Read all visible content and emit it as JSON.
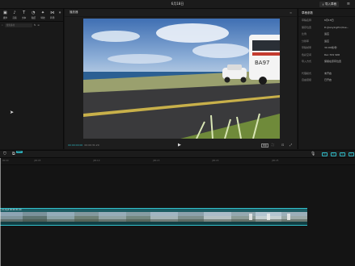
{
  "titlebar": {
    "project_date": "6月18日",
    "share_label": "导入草稿",
    "menu_glyph": "≡"
  },
  "toolbar": {
    "items": [
      {
        "icon": "media-icon",
        "glyph": "▣",
        "label": "媒体"
      },
      {
        "icon": "audio-icon",
        "glyph": "♪",
        "label": "音频"
      },
      {
        "icon": "text-icon",
        "glyph": "T",
        "label": "文本"
      },
      {
        "icon": "sticker-icon",
        "glyph": "◔",
        "label": "贴纸"
      },
      {
        "icon": "effects-icon",
        "glyph": "✦",
        "label": "特效"
      },
      {
        "icon": "transition-icon",
        "glyph": "⋈",
        "label": "转场"
      }
    ],
    "more_glyph": "»"
  },
  "media_search": {
    "placeholder": "搜索素材",
    "sort_glyph": "⇅",
    "filter_glyph": "≡"
  },
  "player": {
    "header": "播放器",
    "options_glyph": "≡",
    "current_time": "00:00:00:00",
    "total_time": "00:00:31:20",
    "play_glyph": "▶",
    "ratio_label": "原始",
    "bus_text": "BA97"
  },
  "details": {
    "header": "草稿参数",
    "rows": [
      {
        "key": "草稿名称",
        "value": "6月18日"
      },
      {
        "key": "保存位置",
        "value": "D:/JianyingPro/Use..."
      },
      {
        "key": "比例",
        "value": "适应"
      },
      {
        "key": "分辨率",
        "value": "适应"
      },
      {
        "key": "草稿帧率",
        "value": "30.00帧/秒"
      },
      {
        "key": "色彩空间",
        "value": "Rec.709 SDR"
      },
      {
        "key": "导入方式",
        "value": "保留在原有位置"
      },
      {
        "key": "代理模式",
        "value": "未开启"
      },
      {
        "key": "自由层级",
        "value": "已开启"
      }
    ]
  },
  "timeline": {
    "badge": "NEW",
    "ruler": [
      "00:00",
      "|00:05",
      "|00:10",
      "|00:15",
      "|00:20",
      "|00:25"
    ],
    "clip_label": "21.mp4  00:00:31:20"
  },
  "colors": {
    "accent": "#2fb8c4",
    "clip": "#1c5c63",
    "background": "#141414"
  }
}
